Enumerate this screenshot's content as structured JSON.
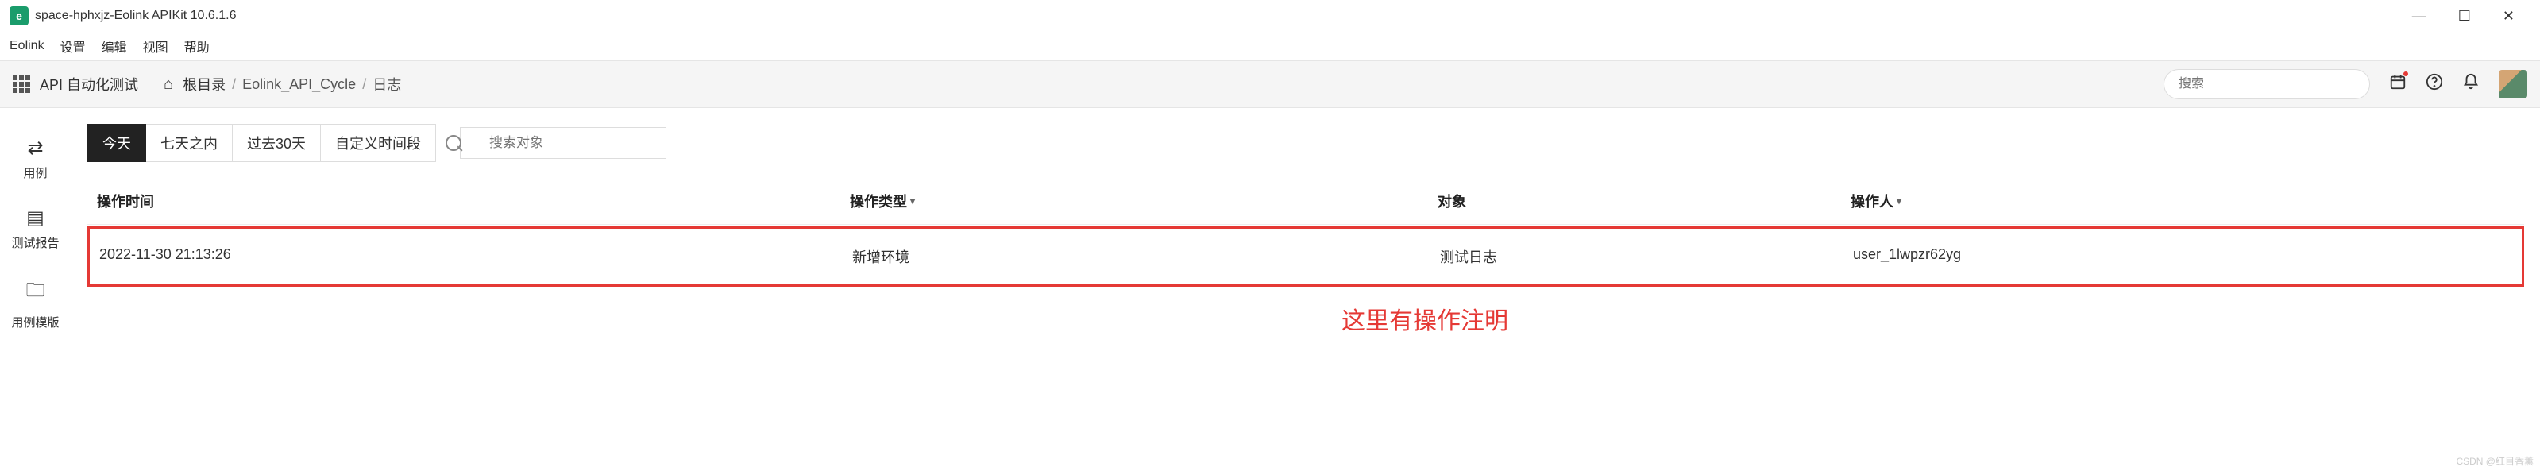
{
  "window": {
    "title": "space-hphxjz-Eolink APIKit 10.6.1.6",
    "app_icon_letter": "e"
  },
  "menu": {
    "items": [
      "Eolink",
      "设置",
      "编辑",
      "视图",
      "帮助"
    ]
  },
  "toolbar": {
    "section": "API 自动化测试",
    "breadcrumb": {
      "root": "根目录",
      "mid": "Eolink_API_Cycle",
      "leaf": "日志"
    },
    "search_placeholder": "搜索"
  },
  "sidebar": {
    "items": [
      {
        "icon": "⇄",
        "label": "用例"
      },
      {
        "icon": "▤",
        "label": "测试报告"
      },
      {
        "icon": "🗀",
        "label": "用例模版"
      }
    ]
  },
  "filters": {
    "tabs": [
      "今天",
      "七天之内",
      "过去30天",
      "自定义时间段"
    ],
    "search_placeholder": "搜索对象"
  },
  "table": {
    "headers": {
      "time": "操作时间",
      "type": "操作类型",
      "obj": "对象",
      "op": "操作人"
    },
    "rows": [
      {
        "time": "2022-11-30 21:13:26",
        "type": "新增环境",
        "obj": "测试日志",
        "op": "user_1lwpzr62yg"
      }
    ]
  },
  "annotation": "这里有操作注明",
  "watermark": "CSDN @红目香薰"
}
